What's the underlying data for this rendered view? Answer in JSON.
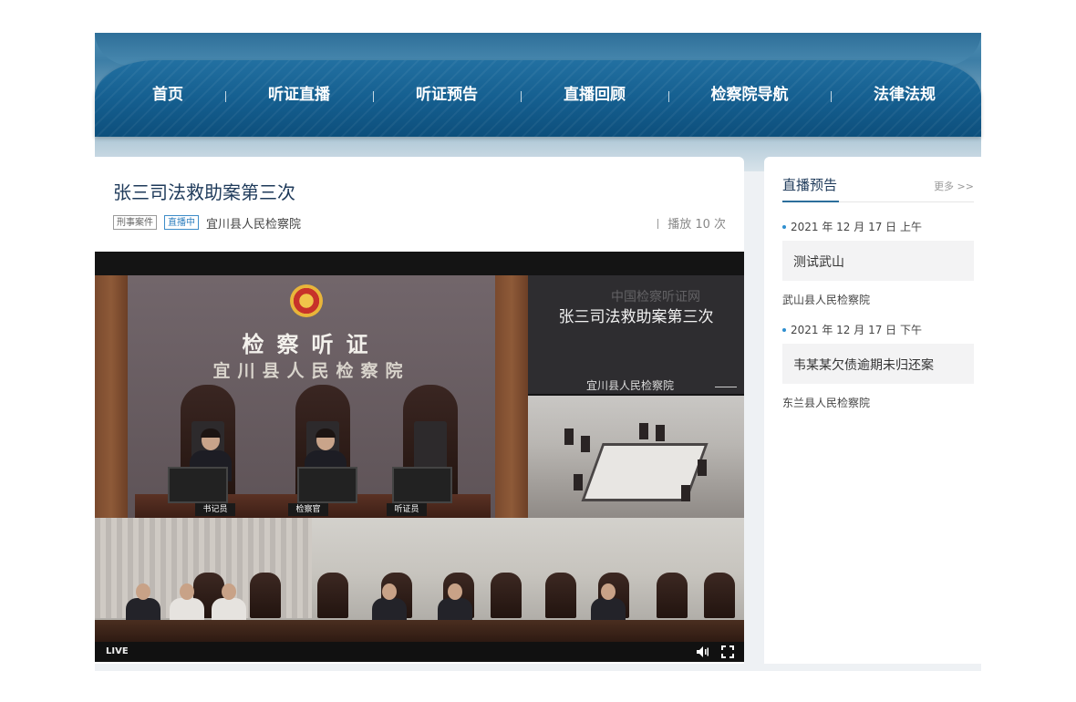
{
  "nav": {
    "items": [
      "首页",
      "听证直播",
      "听证预告",
      "直播回顾",
      "检察院导航",
      "法律法规"
    ]
  },
  "main": {
    "title": "张三司法救助案第三次",
    "tags": [
      "刑事案件",
      "直播中"
    ],
    "org": "宜川县人民检察院",
    "play_count": "播放 10 次"
  },
  "video": {
    "court_title_1": "检察听证",
    "court_title_2": "宜川县人民检察院",
    "nameplates": [
      "书记员",
      "检察官",
      "听证员"
    ],
    "watermark": "中国检察听证网",
    "overlay_title": "张三司法救助案第三次",
    "overlay_org": "宜川县人民检察院",
    "live_label": "LIVE",
    "icons": [
      "volume-icon",
      "fullscreen-icon"
    ]
  },
  "sidebar": {
    "title": "直播预告",
    "more": "更多 >>",
    "events": [
      {
        "date": "2021 年 12 月 17 日 上午",
        "title": "测试武山",
        "org": "武山县人民检察院"
      },
      {
        "date": "2021 年 12 月 17 日 下午",
        "title": "韦某某欠债逾期未归还案",
        "org": "东兰县人民检察院"
      }
    ]
  },
  "colors": {
    "nav_blue": "#135c8b",
    "title_navy": "#1e3a5a",
    "live_tag_blue": "#2f7fbf",
    "bullet_blue": "#2f8fcf"
  }
}
